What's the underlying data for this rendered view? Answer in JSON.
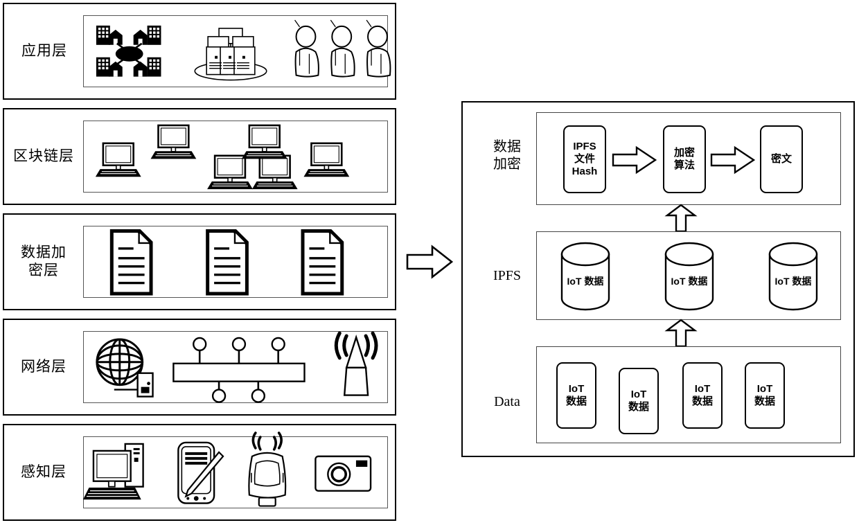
{
  "diagram": {
    "title": "IoT blockchain layered architecture with IPFS data encryption",
    "stroke_color": "#000000",
    "inner_border_color": "#555555",
    "background": "#ffffff"
  },
  "left_stack": {
    "layers": [
      {
        "id": "application-layer",
        "label_lines": [
          "应用层"
        ],
        "icons": [
          "buildings-network-icon",
          "server-cluster-icon",
          "users-group-icon"
        ]
      },
      {
        "id": "blockchain-layer",
        "label_lines": [
          "区块链层"
        ],
        "icons": [
          "desktop-computer-icon",
          "desktop-computer-icon",
          "desktop-computer-icon",
          "desktop-computer-icon",
          "desktop-computer-icon",
          "desktop-computer-icon"
        ]
      },
      {
        "id": "data-encryption-layer",
        "label_lines": [
          "数据加",
          "密层"
        ],
        "icons": [
          "document-icon",
          "document-icon",
          "document-icon"
        ]
      },
      {
        "id": "network-layer",
        "label_lines": [
          "网络层"
        ],
        "icons": [
          "globe-device-icon",
          "bus-topology-icon",
          "wireless-tower-icon"
        ]
      },
      {
        "id": "perception-layer",
        "label_lines": [
          "感知层"
        ],
        "icons": [
          "desktop-pc-tower-icon",
          "smartphone-stylus-icon",
          "connected-car-icon",
          "camera-icon"
        ]
      }
    ]
  },
  "connector": {
    "name": "flow-arrow-right",
    "direction": "right"
  },
  "right_panel": {
    "sections": [
      {
        "id": "data-encryption-section",
        "label_lines": [
          "数据",
          "加密"
        ],
        "boxes": [
          {
            "name": "ipfs-file-hash-box",
            "lines": [
              "IPFS",
              "文件",
              "Hash"
            ]
          },
          {
            "name": "encryption-algorithm-box",
            "lines": [
              "加密",
              "算法"
            ]
          },
          {
            "name": "ciphertext-box",
            "lines": [
              "密文"
            ]
          }
        ],
        "arrows": [
          "arrow-right",
          "arrow-right"
        ]
      },
      {
        "id": "ipfs-section",
        "label_lines": [
          "IPFS"
        ],
        "cylinders": [
          {
            "name": "iot-data-cylinder",
            "lines": [
              "IoT",
              "数据"
            ]
          },
          {
            "name": "iot-data-cylinder",
            "lines": [
              "IoT",
              "数据"
            ]
          },
          {
            "name": "iot-data-cylinder",
            "lines": [
              "IoT",
              "数据"
            ]
          }
        ]
      },
      {
        "id": "data-section",
        "label_lines": [
          "Data"
        ],
        "boxes": [
          {
            "name": "iot-data-box",
            "lines": [
              "IoT",
              "数据"
            ]
          },
          {
            "name": "iot-data-box",
            "lines": [
              "IoT",
              "数据"
            ]
          },
          {
            "name": "iot-data-box",
            "lines": [
              "IoT",
              "数据"
            ]
          },
          {
            "name": "iot-data-box",
            "lines": [
              "IoT",
              "数据"
            ]
          }
        ]
      }
    ],
    "vertical_arrows": [
      {
        "name": "ipfs-to-encryption-arrow",
        "direction": "up"
      },
      {
        "name": "data-to-ipfs-arrow",
        "direction": "up"
      }
    ]
  }
}
